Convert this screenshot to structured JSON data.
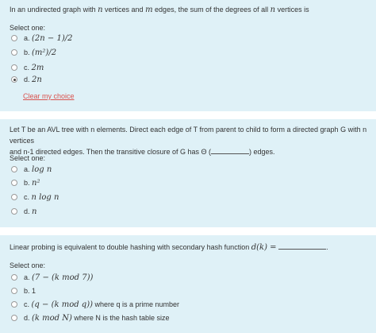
{
  "q1": {
    "text_a": "In an undirected graph with ",
    "var_n": "n",
    "text_b": " vertices and ",
    "var_m": "m",
    "text_c": " edges, the sum of the degrees of all ",
    "var_n2": "n",
    "text_d": " vertices is",
    "select_one": "Select one:",
    "options": [
      {
        "prefix": "a.",
        "math": "(2n − 1)/2",
        "checked": false
      },
      {
        "prefix": "b.",
        "math": "(m²)/2",
        "checked": false
      },
      {
        "prefix": "c.",
        "math": "2m",
        "checked": false
      },
      {
        "prefix": "d.",
        "math": "2n",
        "checked": true
      }
    ],
    "clear": "Clear my choice"
  },
  "q2": {
    "line1_a": "Let T be an AVL tree with n elements. Direct each edge of T from parent to child to form a directed graph G with n vertices",
    "line2_a": "and n-1 directed edges. Then the transitive closure of G has Θ (",
    "line2_b": ") edges.",
    "select_one": "Select one:",
    "options": [
      {
        "prefix": "a.",
        "math": "log n"
      },
      {
        "prefix": "b.",
        "math": "n²"
      },
      {
        "prefix": "c.",
        "math": "n log n"
      },
      {
        "prefix": "d.",
        "math": "n"
      }
    ]
  },
  "q3": {
    "text_a": "Linear probing is equivalent to double hashing with secondary hash function ",
    "math": "d(k) =",
    "text_b": ".",
    "select_one": "Select one:",
    "options": [
      {
        "prefix": "a.",
        "math": "(7 − (k  mod 7))",
        "suffix": ""
      },
      {
        "prefix": "b.",
        "math": "",
        "suffix": "1"
      },
      {
        "prefix": "c.",
        "math": "(q − (k  mod q))",
        "suffix": "  where q is a prime number"
      },
      {
        "prefix": "d.",
        "math": "(k  mod N)",
        "suffix": "  where N is the hash table size"
      }
    ]
  }
}
